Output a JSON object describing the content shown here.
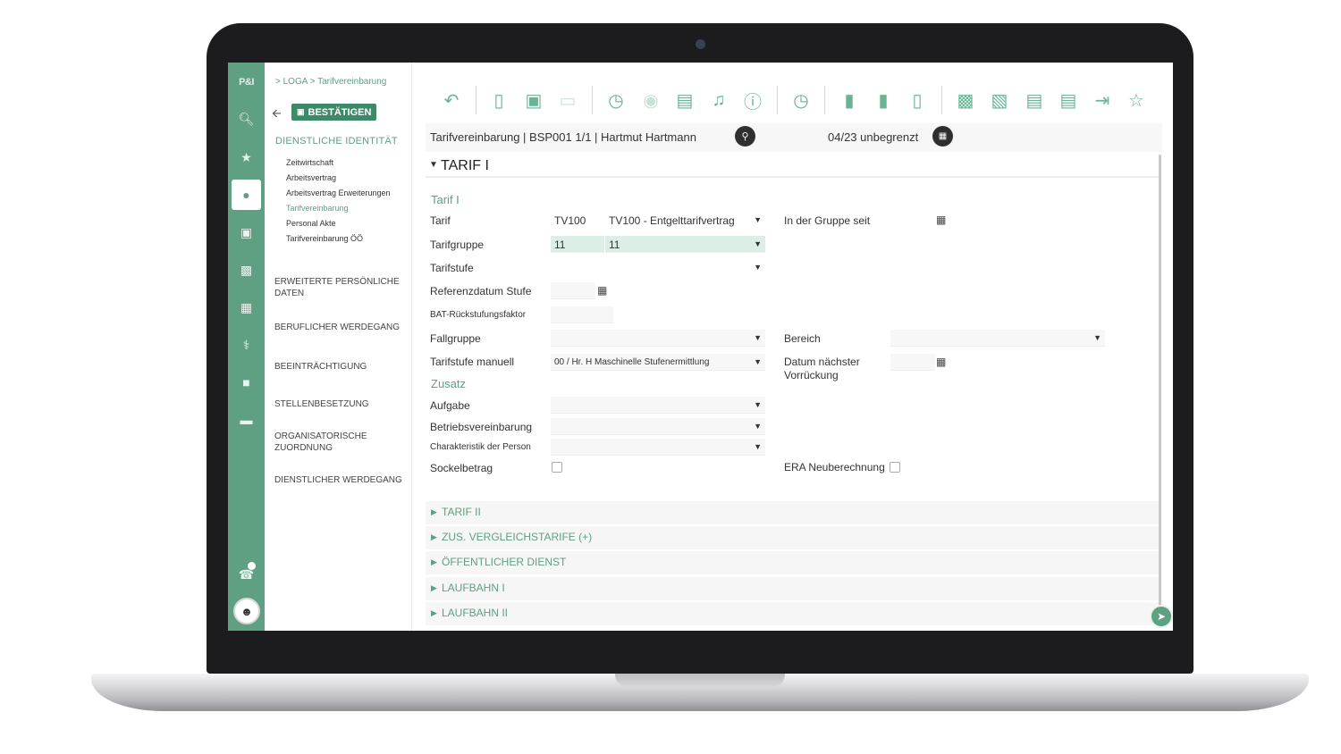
{
  "breadcrumb": "> LOGA > Tarifvereinbarung",
  "confirm_label": "BESTÄTIGEN",
  "logo_text": "P&I",
  "nav": {
    "section_title": "DIENSTLICHE IDENTITÄT",
    "subitems": [
      "Zeitwirtschaft",
      "Arbeitsvertrag",
      "Arbeitsvertrag Erweiterungen",
      "Tarifvereinbarung",
      "Personal Akte",
      "Tarifvereinbarung ÖÖ"
    ],
    "sections": [
      "ERWEITERTE PERSÖNLICHE DATEN",
      "BERUFLICHER WERDEGANG",
      "BEEINTRÄCHTIGUNG",
      "STELLENBESETZUNG",
      "ORGANISATORISCHE ZUORDNUNG",
      "DIENSTLICHER WERDEGANG"
    ]
  },
  "record": {
    "title": "Tarifvereinbarung | BSP001 1/1 | Hartmut Hartmann",
    "period": "04/23 unbegrenzt"
  },
  "panel_title": "TARIF I",
  "form": {
    "subhead_tarif": "Tarif I",
    "subhead_zusatz": "Zusatz",
    "tarif_label": "Tarif",
    "tarif_code": "TV100",
    "tarif_value": "TV100 - Entgelttarifvertrag",
    "gruppe_seit_label": "In der Gruppe seit",
    "tarifgruppe_label": "Tarifgruppe",
    "tarifgruppe_code": "11",
    "tarifgruppe_value": "11",
    "tarifstufe_label": "Tarifstufe",
    "referenzdatum_label": "Referenzdatum Stufe",
    "bat_label": "BAT-Rückstufungsfaktor",
    "fallgruppe_label": "Fallgruppe",
    "bereich_label": "Bereich",
    "tarifstufe_manuell_label": "Tarifstufe manuell",
    "tarifstufe_manuell_value": "00 / Hr. H Maschinelle Stufenermittlung",
    "datum_vorrueckung_label": "Datum nächster Vorrückung",
    "aufgabe_label": "Aufgabe",
    "betriebsvereinbarung_label": "Betriebsvereinbarung",
    "charakteristik_label": "Charakteristik der Person",
    "sockelbetrag_label": "Sockelbetrag",
    "era_label": "ERA Neuberechnung"
  },
  "collapsed_sections": [
    "TARIF II",
    "ZUS. VERGLEICHSTARIFE (+)",
    "ÖFFENTLICHER DIENST",
    "LAUFBAHN I",
    "LAUFBAHN II"
  ],
  "colors": {
    "accent": "#5f9f82",
    "accent_dark": "#3d8a68",
    "highlight": "#dcefe6"
  }
}
